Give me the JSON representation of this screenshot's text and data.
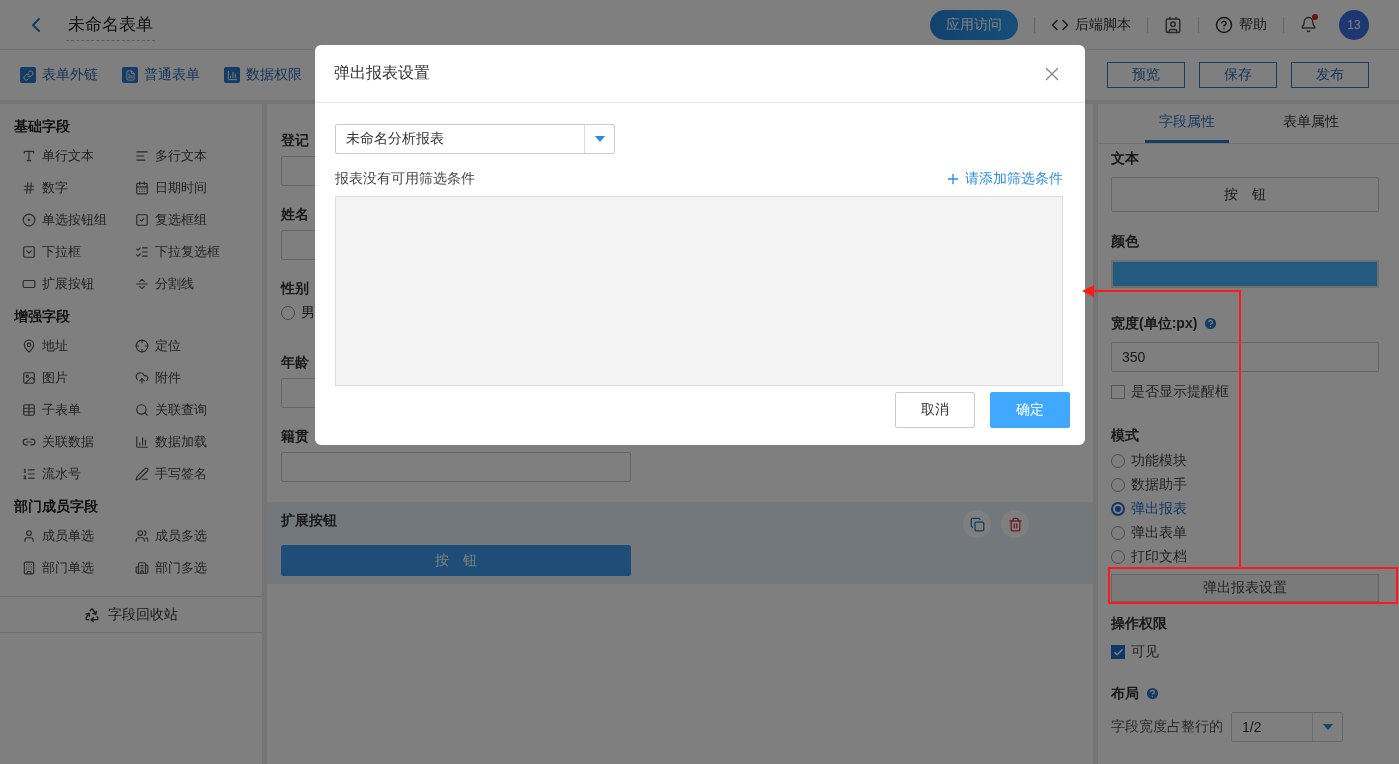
{
  "header": {
    "title": "未命名表单",
    "visit_button": "应用访问",
    "items": [
      {
        "kind": "script",
        "label": "后端脚本"
      },
      {
        "kind": "contacts"
      },
      {
        "kind": "help",
        "label": "帮助"
      },
      {
        "kind": "bell",
        "unread": true
      },
      {
        "kind": "avatar",
        "label": "13"
      }
    ]
  },
  "toolbar": {
    "tabs": [
      {
        "kind": "link",
        "label": "表单外链"
      },
      {
        "kind": "form",
        "label": "普通表单"
      },
      {
        "kind": "chart",
        "label": "数据权限"
      }
    ],
    "buttons": [
      "预览",
      "保存",
      "发布"
    ]
  },
  "palette": {
    "sections": [
      {
        "title": "基础字段",
        "items": [
          "单行文本",
          "多行文本",
          "数字",
          "日期时间",
          "单选按钮组",
          "复选框组",
          "下拉框",
          "下拉复选框",
          "扩展按钮",
          "分割线"
        ]
      },
      {
        "title": "增强字段",
        "items": [
          "地址",
          "定位",
          "图片",
          "附件",
          "子表单",
          "关联查询",
          "关联数据",
          "数据加载",
          "流水号",
          "手写签名"
        ]
      },
      {
        "title": "部门成员字段",
        "items": [
          "成员单选",
          "成员多选",
          "部门单选",
          "部门多选"
        ]
      }
    ],
    "recycle": "字段回收站"
  },
  "form": {
    "fields": [
      {
        "kind": "input",
        "label": "登记"
      },
      {
        "kind": "input",
        "label": "姓名"
      },
      {
        "kind": "radio",
        "label": "性别",
        "options": [
          {
            "label": "男",
            "selected": false
          }
        ]
      },
      {
        "kind": "input",
        "label": "年龄"
      },
      {
        "kind": "input",
        "label": "籍贯"
      }
    ],
    "active_block": {
      "label": "扩展按钮",
      "button": "按　钮"
    }
  },
  "properties": {
    "tabs": [
      {
        "label": "字段属性",
        "selected": true
      },
      {
        "label": "表单属性",
        "selected": false
      }
    ],
    "text": {
      "label": "文本",
      "value": "按　钮"
    },
    "color": {
      "label": "颜色",
      "color": "#225b7f"
    },
    "width": {
      "label": "宽度(单位:px)",
      "value": "350"
    },
    "reminder": {
      "label": "是否显示提醒框",
      "checked": false
    },
    "mode": {
      "label": "模式",
      "options": [
        {
          "label": "功能模块",
          "selected": false
        },
        {
          "label": "数据助手",
          "selected": false
        },
        {
          "label": "弹出报表",
          "selected": true
        },
        {
          "label": "弹出表单",
          "selected": false
        },
        {
          "label": "打印文档",
          "selected": false
        }
      ]
    },
    "settings_button": "弹出报表设置",
    "permission": {
      "label": "操作权限",
      "option": {
        "label": "可见",
        "checked": true
      }
    },
    "layout": {
      "label": "布局",
      "width_label": "字段宽度占整行的",
      "width_value": "1/2"
    }
  },
  "modal": {
    "title": "弹出报表设置",
    "report_select": "未命名分析报表",
    "empty_message": "报表没有可用筛选条件",
    "add_link": "请添加筛选条件",
    "buttons": [
      {
        "kind": "cancel",
        "label": "取消"
      },
      {
        "kind": "confirm",
        "label": "确定"
      }
    ]
  }
}
